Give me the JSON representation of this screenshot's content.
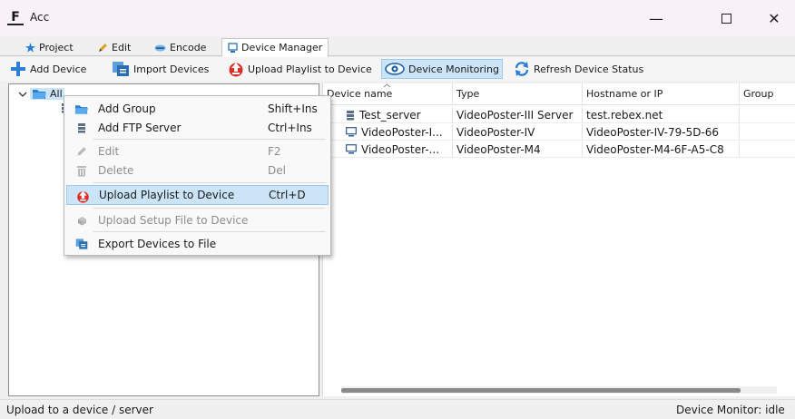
{
  "window": {
    "app_icon_letter": "F",
    "title": "Acc",
    "minimize_glyph": "—",
    "close_glyph": "✕"
  },
  "tabs": [
    {
      "label": "Project",
      "icon": "star-icon"
    },
    {
      "label": "Edit",
      "icon": "pencil-icon"
    },
    {
      "label": "Encode",
      "icon": "encode-icon"
    },
    {
      "label": "Device Manager",
      "icon": "device-icon",
      "active": true
    }
  ],
  "toolbar": [
    {
      "label": "Add Device",
      "icon": "plus-icon"
    },
    {
      "label": "Import Devices",
      "icon": "import-icon"
    },
    {
      "label": "Upload Playlist to Device",
      "icon": "upload-icon"
    },
    {
      "label": "Device Monitoring",
      "icon": "eye-icon",
      "active": true
    },
    {
      "label": "Refresh Device Status",
      "icon": "refresh-icon"
    }
  ],
  "tree": {
    "root_label": "All"
  },
  "context_menu": [
    {
      "label": "Add Group",
      "shortcut": "Shift+Ins",
      "icon": "folder-icon",
      "enabled": true
    },
    {
      "label": "Add FTP Server",
      "shortcut": "Ctrl+Ins",
      "icon": "server-icon",
      "enabled": true
    },
    {
      "label": "Edit",
      "shortcut": "F2",
      "icon": "pencil-icon",
      "enabled": false
    },
    {
      "label": "Delete",
      "shortcut": "Del",
      "icon": "trash-icon",
      "enabled": false
    },
    {
      "label": "Upload Playlist to Device",
      "shortcut": "Ctrl+D",
      "icon": "upload-icon",
      "enabled": true,
      "highlighted": true
    },
    {
      "label": "Upload Setup File to Device",
      "shortcut": "",
      "icon": "box-icon",
      "enabled": false
    },
    {
      "label": "Export Devices to File",
      "shortcut": "",
      "icon": "export-icon",
      "enabled": true
    }
  ],
  "device_list": {
    "columns": [
      "Device name",
      "Type",
      "Hostname or IP",
      "Group"
    ],
    "rows": [
      {
        "name": "Test_server",
        "type": "VideoPoster-III Server",
        "host": "test.rebex.net",
        "group": "",
        "icon": "server-icon"
      },
      {
        "name": "VideoPoster-I...",
        "type": "VideoPoster-IV",
        "host": "VideoPoster-IV-79-5D-66",
        "group": "",
        "icon": "monitor-icon"
      },
      {
        "name": "VideoPoster-...",
        "type": "VideoPoster-M4",
        "host": "VideoPoster-M4-6F-A5-C8",
        "group": "",
        "icon": "monitor-icon"
      }
    ]
  },
  "status": {
    "left": "Upload to a device / server",
    "right": "Device Monitor: idle"
  },
  "colors": {
    "selection": "#cce4f7",
    "selection_border": "#99c9ef",
    "titlebar": "#f8f2f6",
    "upload_red": "#d9312a",
    "blue_accent": "#2a7fd4"
  }
}
